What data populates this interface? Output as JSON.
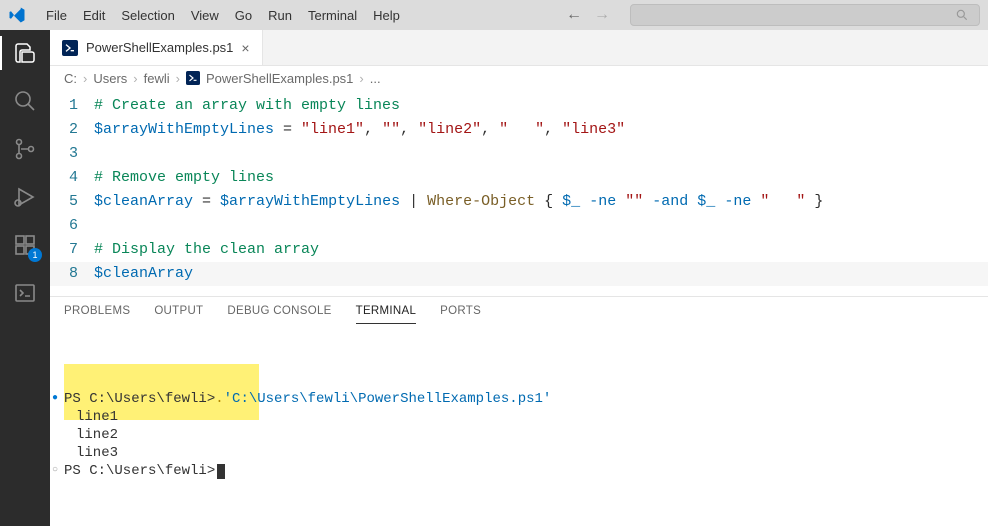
{
  "menubar": {
    "items": [
      "File",
      "Edit",
      "Selection",
      "View",
      "Go",
      "Run",
      "Terminal",
      "Help"
    ]
  },
  "activitybar": {
    "badge": "1"
  },
  "tab": {
    "filename": "PowerShellExamples.ps1"
  },
  "breadcrumbs": {
    "parts": [
      "C:",
      "Users",
      "fewli",
      "PowerShellExamples.ps1",
      "..."
    ]
  },
  "code": {
    "lines": [
      {
        "n": "1",
        "tokens": [
          {
            "c": "tok-comment",
            "t": "# Create an array with empty lines"
          }
        ]
      },
      {
        "n": "2",
        "tokens": [
          {
            "c": "tok-var",
            "t": "$arrayWithEmptyLines"
          },
          {
            "c": "tok-op",
            "t": " = "
          },
          {
            "c": "tok-str",
            "t": "\"line1\""
          },
          {
            "c": "tok-op",
            "t": ", "
          },
          {
            "c": "tok-str",
            "t": "\"\""
          },
          {
            "c": "tok-op",
            "t": ", "
          },
          {
            "c": "tok-str",
            "t": "\"line2\""
          },
          {
            "c": "tok-op",
            "t": ", "
          },
          {
            "c": "tok-str",
            "t": "\"   \""
          },
          {
            "c": "tok-op",
            "t": ", "
          },
          {
            "c": "tok-str",
            "t": "\"line3\""
          }
        ]
      },
      {
        "n": "3",
        "tokens": []
      },
      {
        "n": "4",
        "tokens": [
          {
            "c": "tok-comment",
            "t": "# Remove empty lines"
          }
        ]
      },
      {
        "n": "5",
        "tokens": [
          {
            "c": "tok-var",
            "t": "$cleanArray"
          },
          {
            "c": "tok-op",
            "t": " = "
          },
          {
            "c": "tok-var",
            "t": "$arrayWithEmptyLines"
          },
          {
            "c": "tok-pipe",
            "t": " | "
          },
          {
            "c": "tok-cmd",
            "t": "Where-Object"
          },
          {
            "c": "tok-op",
            "t": " "
          },
          {
            "c": "tok-brace",
            "t": "{ "
          },
          {
            "c": "tok-var",
            "t": "$_"
          },
          {
            "c": "tok-op",
            "t": " "
          },
          {
            "c": "tok-kw",
            "t": "-ne"
          },
          {
            "c": "tok-op",
            "t": " "
          },
          {
            "c": "tok-str",
            "t": "\"\""
          },
          {
            "c": "tok-op",
            "t": " "
          },
          {
            "c": "tok-kw",
            "t": "-and"
          },
          {
            "c": "tok-op",
            "t": " "
          },
          {
            "c": "tok-var",
            "t": "$_"
          },
          {
            "c": "tok-op",
            "t": " "
          },
          {
            "c": "tok-kw",
            "t": "-ne"
          },
          {
            "c": "tok-op",
            "t": " "
          },
          {
            "c": "tok-str",
            "t": "\"   \""
          },
          {
            "c": "tok-brace",
            "t": " }"
          }
        ]
      },
      {
        "n": "6",
        "tokens": []
      },
      {
        "n": "7",
        "tokens": [
          {
            "c": "tok-comment",
            "t": "# Display the clean array"
          }
        ]
      },
      {
        "n": "8",
        "tokens": [
          {
            "c": "tok-var",
            "t": "$cleanArray"
          }
        ],
        "current": true
      }
    ]
  },
  "panel": {
    "tabs": [
      "PROBLEMS",
      "OUTPUT",
      "DEBUG CONSOLE",
      "TERMINAL",
      "PORTS"
    ],
    "active": "TERMINAL"
  },
  "terminal": {
    "prompt1_pre": "PS C:\\Users\\fewli> ",
    "prompt1_cmd_dot": ". ",
    "prompt1_path": "'C:\\Users\\fewli\\PowerShellExamples.ps1'",
    "out1": "line1",
    "out2": "line2",
    "out3": "line3",
    "prompt2": "PS C:\\Users\\fewli> "
  }
}
